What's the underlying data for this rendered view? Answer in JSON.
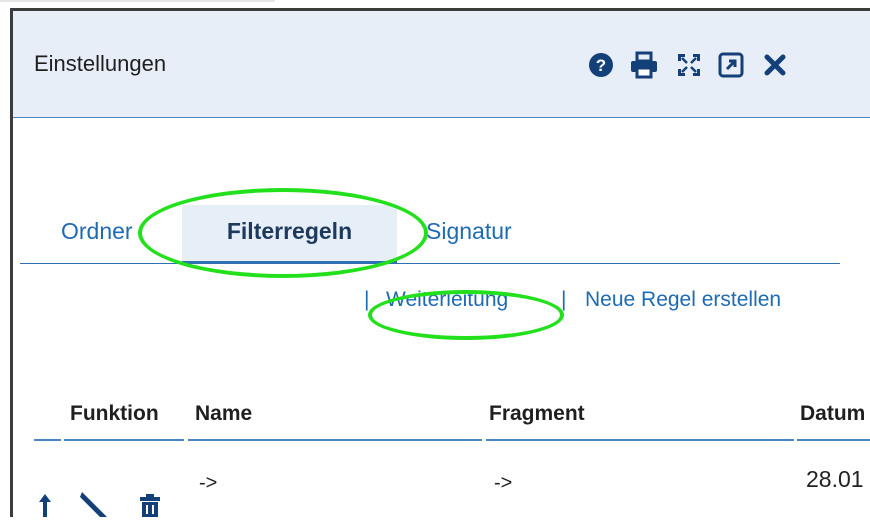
{
  "dialog": {
    "title": "Einstellungen",
    "header_icons": [
      "help-icon",
      "print-icon",
      "expand-icon",
      "open-external-icon",
      "close-icon"
    ]
  },
  "tabs": [
    {
      "label": "Ordner",
      "active": false
    },
    {
      "label": "Filterregeln",
      "active": true
    },
    {
      "label": "Signatur",
      "active": false
    }
  ],
  "sublinks": {
    "separator": "|",
    "forwarding": "Weiterleitung",
    "new_rule": "Neue Regel erstellen"
  },
  "table": {
    "headers": [
      "Funktion",
      "Name",
      "Fragment",
      "Datum"
    ],
    "rows": [
      {
        "actions": [
          "move-up-icon",
          "edit-icon",
          "delete-icon"
        ],
        "name": "->",
        "fragment": "->",
        "date": "28.01"
      }
    ]
  },
  "colors": {
    "accent": "#1d6bb3",
    "header_bg": "#e8eef7",
    "highlight": "#22e01c"
  }
}
